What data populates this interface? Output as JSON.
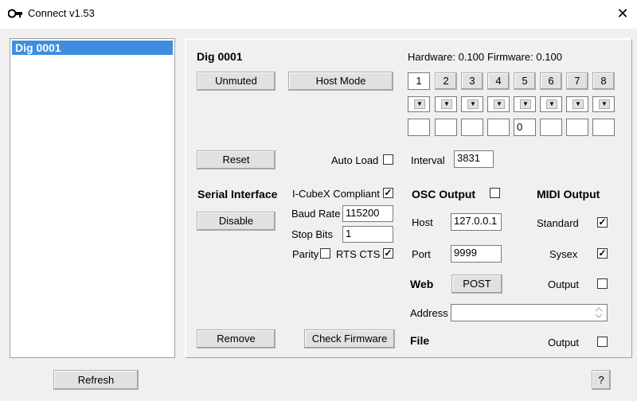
{
  "window": {
    "title": "Connect v1.53",
    "close_glyph": "✕"
  },
  "device_list": {
    "items": [
      "Dig 0001"
    ]
  },
  "device": {
    "name": "Dig 0001",
    "hardware_label": "Hardware: 0.100",
    "firmware_label": "Firmware: 0.100"
  },
  "buttons": {
    "unmuted": "Unmuted",
    "host_mode": "Host Mode",
    "reset": "Reset",
    "disable": "Disable",
    "remove": "Remove",
    "check_firmware": "Check Firmware",
    "refresh": "Refresh",
    "help": "?",
    "post": "POST"
  },
  "channels": {
    "labels": [
      "1",
      "2",
      "3",
      "4",
      "5",
      "6",
      "7",
      "8"
    ],
    "dropdown_glyph": "▼",
    "values": [
      "",
      "",
      "",
      "",
      "0",
      "",
      "",
      ""
    ]
  },
  "auto_load": {
    "label": "Auto Load",
    "checked": ""
  },
  "interval": {
    "label": "Interval",
    "value": "3831"
  },
  "serial": {
    "heading": "Serial Interface",
    "icubex_label": "I-CubeX Compliant",
    "icubex_checked": "✓",
    "baud_label": "Baud Rate",
    "baud_value": "115200",
    "stop_label": "Stop Bits",
    "stop_value": "1",
    "parity_label": "Parity",
    "parity_checked": "",
    "rts_label": "RTS CTS",
    "rts_checked": "✓"
  },
  "osc": {
    "heading": "OSC Output",
    "checked": "",
    "host_label": "Host",
    "host_value": "127.0.0.1",
    "port_label": "Port",
    "port_value": "9999"
  },
  "midi": {
    "heading": "MIDI Output",
    "standard_label": "Standard",
    "standard_checked": "✓",
    "sysex_label": "Sysex",
    "sysex_checked": "✓"
  },
  "web": {
    "heading": "Web",
    "output_label": "Output",
    "output_checked": "",
    "address_label": "Address",
    "address_value": ""
  },
  "file": {
    "heading": "File",
    "output_label": "Output",
    "output_checked": ""
  }
}
